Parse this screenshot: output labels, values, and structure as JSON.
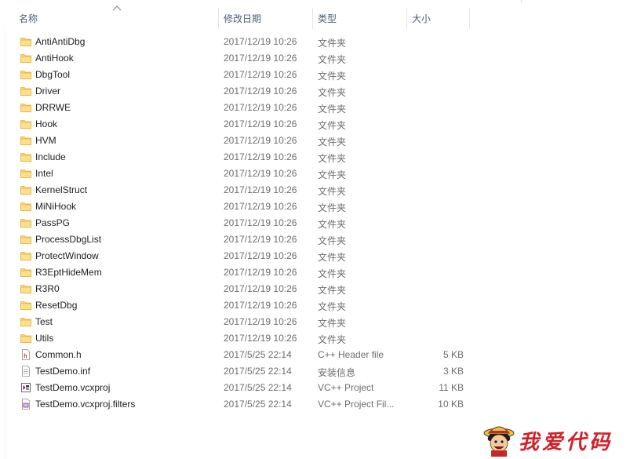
{
  "columns": {
    "name": "名称",
    "date": "修改日期",
    "type": "类型",
    "size": "大小"
  },
  "rows": [
    {
      "kind": "folder",
      "name": "AntiAntiDbg",
      "date": "2017/12/19 10:26",
      "type": "文件夹",
      "size": ""
    },
    {
      "kind": "folder",
      "name": "AntiHook",
      "date": "2017/12/19 10:26",
      "type": "文件夹",
      "size": ""
    },
    {
      "kind": "folder",
      "name": "DbgTool",
      "date": "2017/12/19 10:26",
      "type": "文件夹",
      "size": ""
    },
    {
      "kind": "folder",
      "name": "Driver",
      "date": "2017/12/19 10:26",
      "type": "文件夹",
      "size": ""
    },
    {
      "kind": "folder",
      "name": "DRRWE",
      "date": "2017/12/19 10:26",
      "type": "文件夹",
      "size": ""
    },
    {
      "kind": "folder",
      "name": "Hook",
      "date": "2017/12/19 10:26",
      "type": "文件夹",
      "size": ""
    },
    {
      "kind": "folder",
      "name": "HVM",
      "date": "2017/12/19 10:26",
      "type": "文件夹",
      "size": ""
    },
    {
      "kind": "folder",
      "name": "Include",
      "date": "2017/12/19 10:26",
      "type": "文件夹",
      "size": ""
    },
    {
      "kind": "folder",
      "name": "Intel",
      "date": "2017/12/19 10:26",
      "type": "文件夹",
      "size": ""
    },
    {
      "kind": "folder",
      "name": "KernelStruct",
      "date": "2017/12/19 10:26",
      "type": "文件夹",
      "size": ""
    },
    {
      "kind": "folder",
      "name": "MiNiHook",
      "date": "2017/12/19 10:26",
      "type": "文件夹",
      "size": ""
    },
    {
      "kind": "folder",
      "name": "PassPG",
      "date": "2017/12/19 10:26",
      "type": "文件夹",
      "size": ""
    },
    {
      "kind": "folder",
      "name": "ProcessDbgList",
      "date": "2017/12/19 10:26",
      "type": "文件夹",
      "size": ""
    },
    {
      "kind": "folder",
      "name": "ProtectWindow",
      "date": "2017/12/19 10:26",
      "type": "文件夹",
      "size": ""
    },
    {
      "kind": "folder",
      "name": "R3EptHideMem",
      "date": "2017/12/19 10:26",
      "type": "文件夹",
      "size": ""
    },
    {
      "kind": "folder",
      "name": "R3R0",
      "date": "2017/12/19 10:26",
      "type": "文件夹",
      "size": ""
    },
    {
      "kind": "folder",
      "name": "ResetDbg",
      "date": "2017/12/19 10:26",
      "type": "文件夹",
      "size": ""
    },
    {
      "kind": "folder",
      "name": "Test",
      "date": "2017/12/19 10:26",
      "type": "文件夹",
      "size": ""
    },
    {
      "kind": "folder",
      "name": "Utils",
      "date": "2017/12/19 10:26",
      "type": "文件夹",
      "size": ""
    },
    {
      "kind": "header-file",
      "name": "Common.h",
      "date": "2017/5/25 22:14",
      "type": "C++ Header file",
      "size": "5 KB"
    },
    {
      "kind": "inf-file",
      "name": "TestDemo.inf",
      "date": "2017/5/25 22:14",
      "type": "安装信息",
      "size": "3 KB"
    },
    {
      "kind": "vcxproj-file",
      "name": "TestDemo.vcxproj",
      "date": "2017/5/25 22:14",
      "type": "VC++ Project",
      "size": "11 KB"
    },
    {
      "kind": "filters-file",
      "name": "TestDemo.vcxproj.filters",
      "date": "2017/5/25 22:14",
      "type": "VC++ Project Fil...",
      "size": "10 KB"
    }
  ],
  "watermark": {
    "text": "我爱代码"
  },
  "colors": {
    "header_text": "#4c607a",
    "folder": "#f8d775",
    "watermark": "#d21f2a"
  }
}
